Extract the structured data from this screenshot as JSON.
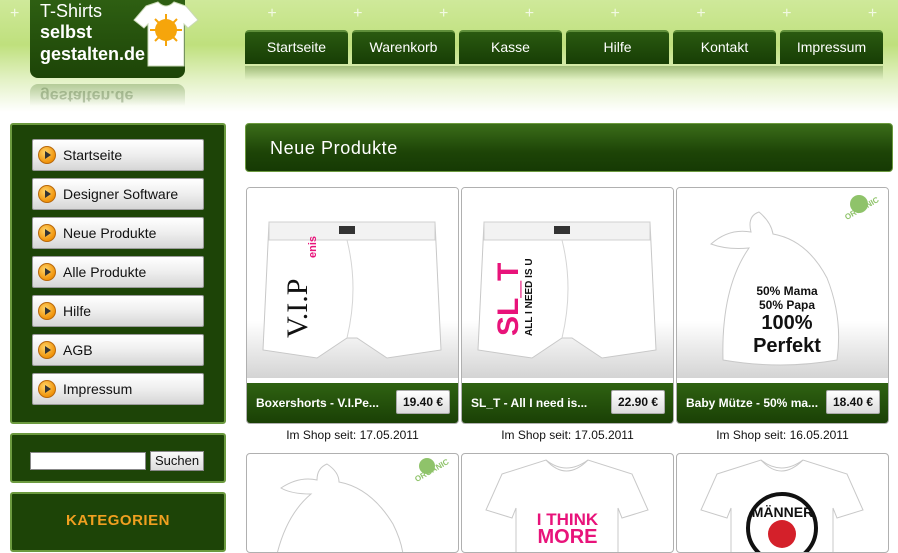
{
  "header": {
    "logo": [
      "T-Shirts",
      "selbst",
      "gestalten.de"
    ],
    "logo_reflection": "gestalten.de",
    "sparkles": "+ + + + + + + + + + + + + + + + + + + + + + +",
    "nav": [
      "Startseite",
      "Warenkorb",
      "Kasse",
      "Hilfe",
      "Kontakt",
      "Impressum"
    ]
  },
  "sidebar": {
    "menu": [
      "Startseite",
      "Designer Software",
      "Neue Produkte",
      "Alle Produkte",
      "Hilfe",
      "AGB",
      "Impressum"
    ],
    "search": {
      "value": "",
      "button": "Suchen"
    },
    "categories_title": "KATEGORIEN"
  },
  "main": {
    "title": "Neue Produkte",
    "products": [
      {
        "name": "Boxershorts - V.I.Pe...",
        "price": "19.40 €",
        "since": "Im Shop seit: 17.05.2011",
        "print_main": "V.I.P",
        "print_small": "enis"
      },
      {
        "name": "SL_T - All I need is...",
        "price": "22.90 €",
        "since": "Im Shop seit: 17.05.2011",
        "print_main": "SL_T",
        "print_small": "ALL I NEED IS U"
      },
      {
        "name": "Baby Mütze - 50% ma...",
        "price": "18.40 €",
        "since": "Im Shop seit: 16.05.2011",
        "print_line1": "50% Mama",
        "print_line2": "50% Papa",
        "print_line3": "100%",
        "print_line4": "Perfekt",
        "badge": "ORGANIC"
      }
    ],
    "row2": [
      {
        "badge": "ORGANIC"
      },
      {
        "print_line1": "I THINK",
        "print_line2": "MORE"
      },
      {
        "print_line1": "MÄNNER"
      }
    ]
  },
  "colors": {
    "dark_green": "#1d4407",
    "light_green": "#bfe07d",
    "accent_orange": "#f0a020",
    "pink": "#e8137a"
  }
}
